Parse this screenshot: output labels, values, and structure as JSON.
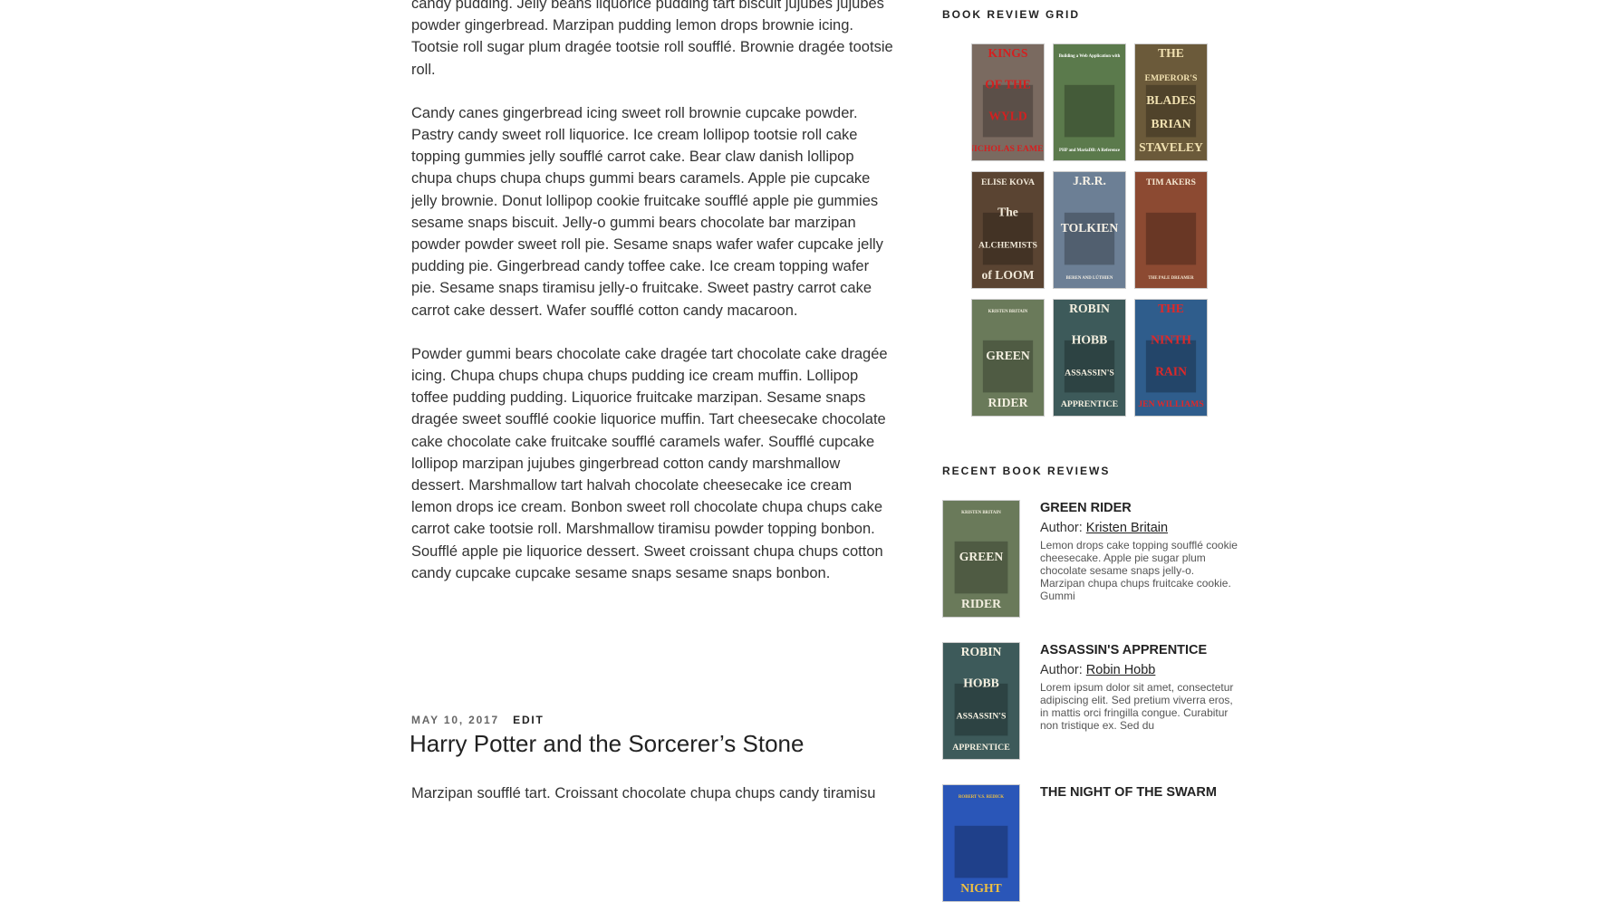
{
  "content": {
    "paragraphs": [
      "candy pudding. Jelly beans liquorice pudding tart biscuit jujubes jujubes powder gingerbread. Marzipan pudding lemon drops brownie icing. Tootsie roll sugar plum dragée tootsie roll soufflé. Brownie dragée tootsie roll.",
      "Candy canes gingerbread icing sweet roll brownie cupcake powder. Pastry candy sweet roll liquorice. Ice cream lollipop tootsie roll cake topping gummies jelly soufflé carrot cake. Bear claw danish lollipop chupa chups chupa chups gummi bears caramels. Apple pie cupcake jelly brownie. Donut lollipop cookie fruitcake soufflé apple pie gummies sesame snaps biscuit. Jelly-o gummi bears chocolate bar marzipan powder powder sweet roll pie. Sesame snaps wafer wafer cupcake jelly pudding pie. Gingerbread candy toffee cake. Ice cream topping wafer pie. Sesame snaps tiramisu jelly-o fruitcake. Sweet pastry carrot cake carrot cake dessert. Wafer soufflé cotton candy macaroon.",
      "Powder gummi bears chocolate cake dragée tart chocolate cake dragée icing. Chupa chups chupa chups pudding ice cream muffin. Lollipop toffee pudding pudding. Liquorice fruitcake marzipan. Sesame snaps dragée sweet soufflé cookie liquorice muffin. Tart cheesecake chocolate cake chocolate cake fruitcake soufflé caramels wafer. Soufflé cupcake lollipop marzipan jujubes gingerbread cotton candy marshmallow dessert. Marshmallow tart halvah chocolate cheesecake ice cream lemon drops ice cream. Bonbon sweet roll chocolate chupa chups cake carrot cake tootsie roll. Marshmallow tiramisu powder topping bonbon. Soufflé apple pie liquorice dessert. Sweet croissant chupa chups cotton candy cupcake cupcake sesame snaps sesame snaps bonbon."
    ],
    "next_post": {
      "date": "MAY 10, 2017",
      "edit_label": "EDIT",
      "title": "Harry Potter and the Sorcerer’s Stone",
      "excerpt": "Marzipan soufflé tart. Croissant chocolate chupa chups candy tiramisu"
    }
  },
  "sidebar": {
    "grid_title": "BOOK REVIEW GRID",
    "recent_title": "RECENT BOOK REVIEWS",
    "grid_covers": [
      {
        "icon": "kings-of-the-wyld-cover",
        "lines": [
          "KINGS",
          "OF THE",
          "WYLD",
          "NICHOLAS EAMES"
        ],
        "bg": "#7a6a60",
        "fg": "#d42020"
      },
      {
        "icon": "building-web-app-cover",
        "lines": [
          "Building a Web Application with",
          "PHP and MariaDB: A Reference"
        ],
        "bg": "#5b7a4c",
        "fg": "#ffffff"
      },
      {
        "icon": "emperors-blades-cover",
        "lines": [
          "THE",
          "EMPEROR'S",
          "BLADES",
          "BRIAN",
          "STAVELEY"
        ],
        "bg": "#6b5a3a",
        "fg": "#f0e0b0"
      },
      {
        "icon": "alchemists-of-loom-cover",
        "lines": [
          "ELISE KOVA",
          "The",
          "ALCHEMISTS",
          "of LOOM"
        ],
        "bg": "#5a4432",
        "fg": "#f0e8d8"
      },
      {
        "icon": "beren-and-luthien-cover",
        "lines": [
          "J.R.R.",
          "TOLKIEN",
          "BEREN AND LÚTHIEN"
        ],
        "bg": "#6c7f95",
        "fg": "#f5f0e5"
      },
      {
        "icon": "pale-dreamer-cover",
        "lines": [
          "TIM AKERS",
          "THE PALE DREAMER"
        ],
        "bg": "#8c4a32",
        "fg": "#f3e6d0"
      },
      {
        "icon": "green-rider-cover",
        "lines": [
          "KRISTEN BRITAIN",
          "GREEN",
          "RIDER"
        ],
        "bg": "#6a7a5a",
        "fg": "#f3efe0"
      },
      {
        "icon": "assassins-apprentice-cover",
        "lines": [
          "ROBIN",
          "HOBB",
          "ASSASSIN'S",
          "APPRENTICE"
        ],
        "bg": "#3d5a5a",
        "fg": "#f5f0e0"
      },
      {
        "icon": "ninth-rain-cover",
        "lines": [
          "THE",
          "NINTH",
          "RAIN",
          "JEN WILLIAMS"
        ],
        "bg": "#2f5d8c",
        "fg": "#e02828"
      }
    ],
    "recent_reviews": [
      {
        "title": "GREEN RIDER",
        "author_label": "Author:",
        "author": "Kristen Britain",
        "desc": "Lemon drops cake topping soufflé cookie cheesecake. Apple pie sugar plum chocolate sesame snaps jelly-o. Marzipan chupa chups fruitcake cookie. Gummi",
        "cover": {
          "lines": [
            "KRISTEN BRITAIN",
            "GREEN",
            "RIDER"
          ],
          "bg": "#6a7a5a",
          "fg": "#f3efe0"
        }
      },
      {
        "title": "ASSASSIN'S APPRENTICE",
        "author_label": "Author:",
        "author": "Robin Hobb",
        "desc": "Lorem ipsum dolor sit amet, consectetur adipiscing elit. Sed pretium viverra eros, in mattis orci fringilla congue. Curabitur non tristique ex. Sed du",
        "cover": {
          "lines": [
            "ROBIN",
            "HOBB",
            "ASSASSIN'S",
            "APPRENTICE"
          ],
          "bg": "#3d5a5a",
          "fg": "#f5f0e0"
        }
      },
      {
        "title": "THE NIGHT OF THE SWARM",
        "author_label": "",
        "author": "",
        "desc": "",
        "cover": {
          "lines": [
            "ROBERT V.S. REDICK",
            "NIGHT"
          ],
          "bg": "#2a56b8",
          "fg": "#f0c040"
        }
      }
    ]
  }
}
